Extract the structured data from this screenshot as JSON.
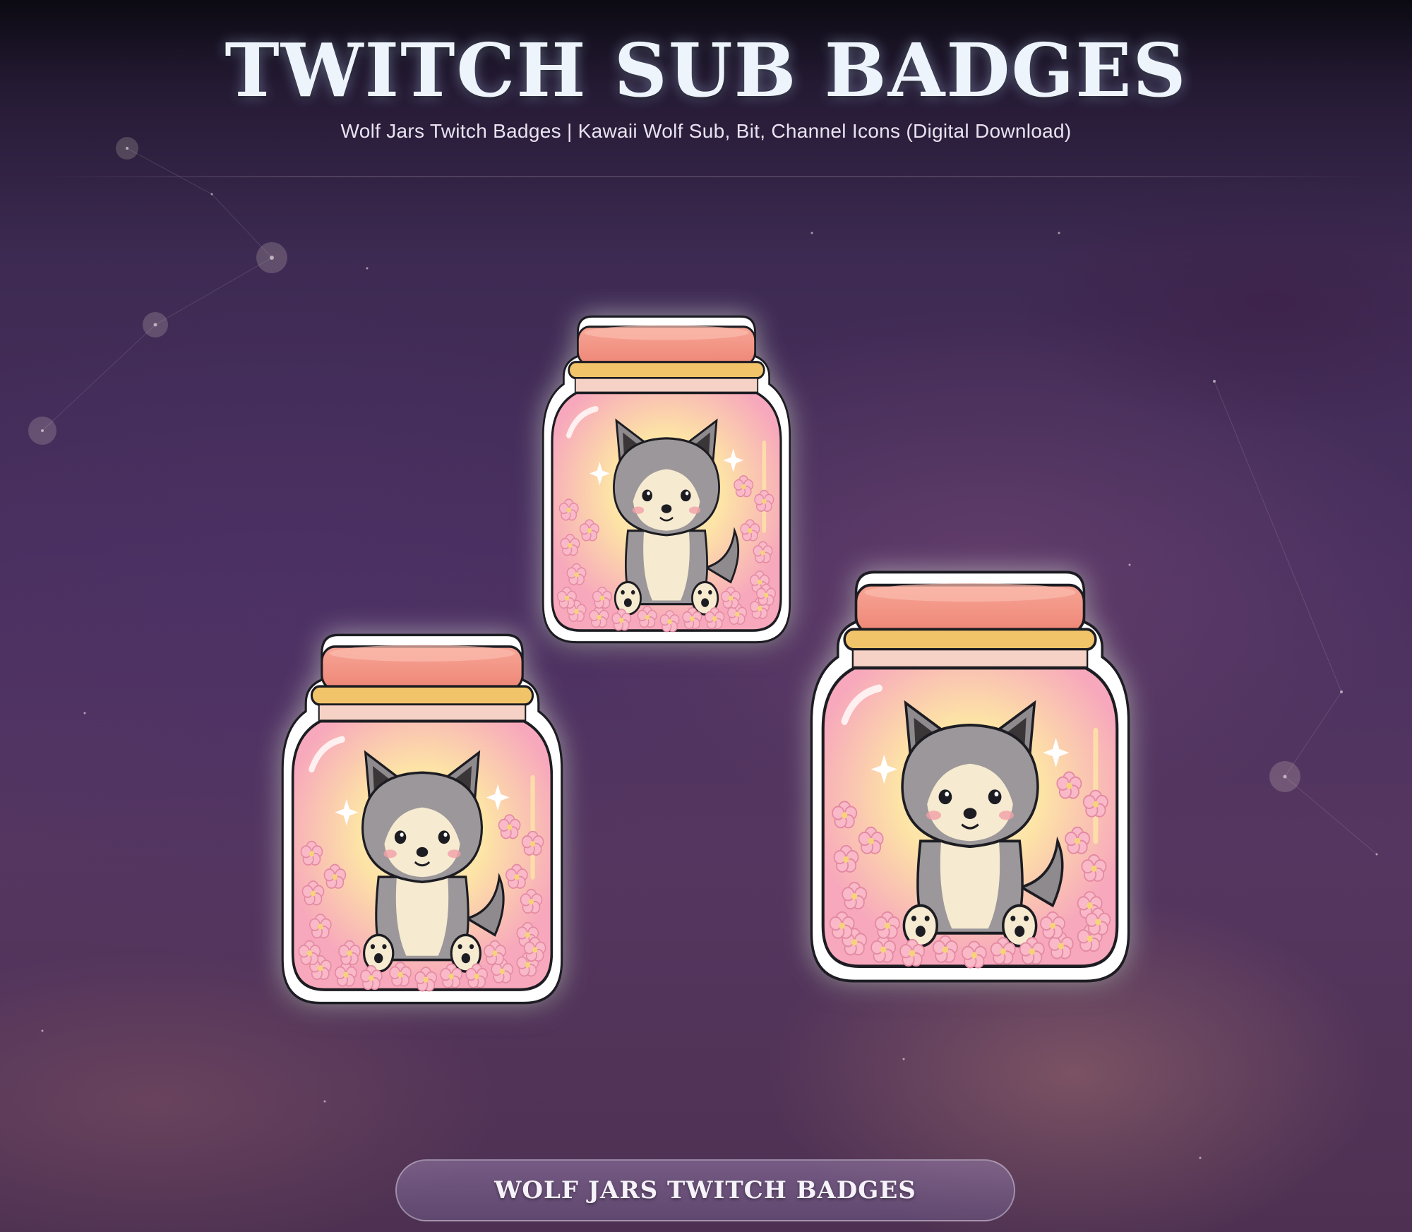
{
  "header": {
    "title": "TWITCH SUB BADGES",
    "subtitle": "Wolf Jars Twitch Badges | Kawaii Wolf Sub, Bit, Channel Icons (Digital Download)"
  },
  "badges": [
    {
      "name": "wolf-jar-badge-small"
    },
    {
      "name": "wolf-jar-badge-medium"
    },
    {
      "name": "wolf-jar-badge-large"
    }
  ],
  "banner": {
    "label": "WOLF JARS TWITCH BADGES"
  },
  "colors": {
    "lid": "#f49a8c",
    "jar": "#f8b3c2",
    "glow": "#fde9a8",
    "wolf_gray": "#8e8a8d",
    "wolf_cream": "#f6ead0",
    "blossom": "#f7b6c6"
  }
}
